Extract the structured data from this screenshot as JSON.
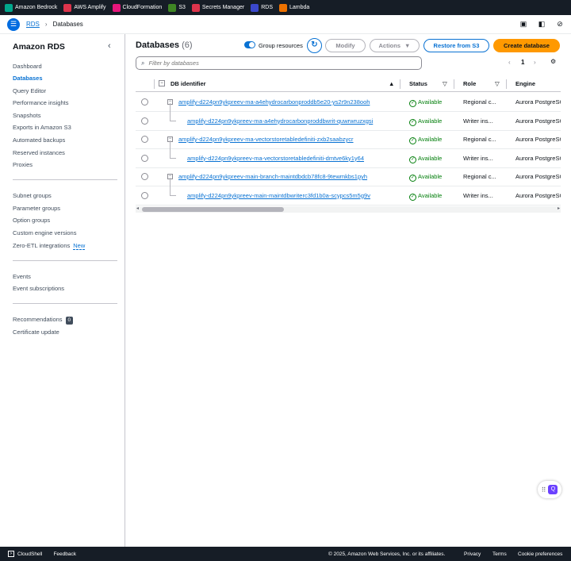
{
  "topbar": {
    "services": [
      {
        "label": "Amazon Bedrock",
        "icon": "bedrock-icon",
        "color": "#01a88d"
      },
      {
        "label": "AWS Amplify",
        "icon": "amplify-icon",
        "color": "#dd344c"
      },
      {
        "label": "CloudFormation",
        "icon": "cloudformation-icon",
        "color": "#e7157b"
      },
      {
        "label": "S3",
        "icon": "s3-icon",
        "color": "#3f8624"
      },
      {
        "label": "Secrets Manager",
        "icon": "secrets-manager-icon",
        "color": "#dd344c"
      },
      {
        "label": "RDS",
        "icon": "rds-icon",
        "color": "#3b48cc"
      },
      {
        "label": "Lambda",
        "icon": "lambda-icon",
        "color": "#ed7100"
      }
    ]
  },
  "breadcrumb": {
    "root": "RDS",
    "current": "Databases"
  },
  "sidebar": {
    "title": "Amazon RDS",
    "group1": [
      "Dashboard",
      "Databases",
      "Query Editor",
      "Performance insights",
      "Snapshots",
      "Exports in Amazon S3",
      "Automated backups",
      "Reserved instances",
      "Proxies"
    ],
    "group2": [
      "Subnet groups",
      "Parameter groups",
      "Option groups",
      "Custom engine versions"
    ],
    "zero_etl": "Zero-ETL integrations",
    "new_tag": "New",
    "group3": [
      "Events",
      "Event subscriptions"
    ],
    "recommendations": "Recommendations",
    "recommendations_count": "0",
    "certificate": "Certificate update"
  },
  "main": {
    "title": "Databases",
    "count": "(6)",
    "group_resources": "Group resources",
    "modify": "Modify",
    "actions": "Actions",
    "restore": "Restore from S3",
    "create": "Create database",
    "filter_placeholder": "Filter by databases",
    "page": "1"
  },
  "table": {
    "columns": [
      "DB identifier",
      "Status",
      "Role",
      "Engine"
    ],
    "rows": [
      {
        "id": "amplify-d224pn9ykpreev-ma-a4ehydrocarbonproddb5e20-ys2r9n238ooh",
        "status": "Available",
        "role": "Regional c...",
        "engine": "Aurora PostgreSQL",
        "child": false
      },
      {
        "id": "amplify-d224pn9ykpreev-ma-a4ehydrocarbonproddbwrit-quwrwruzxgsi",
        "status": "Available",
        "role": "Writer ins...",
        "engine": "Aurora PostgreSQL",
        "child": true
      },
      {
        "id": "amplify-d224pn9ykpreev-ma-vectorstoretabledefiniti-zxb2saabzycr",
        "status": "Available",
        "role": "Regional c...",
        "engine": "Aurora PostgreSQL",
        "child": false
      },
      {
        "id": "amplify-d224pn9ykpreev-ma-vectorstoretabledefiniti-dmtve6ky1y64",
        "status": "Available",
        "role": "Writer ins...",
        "engine": "Aurora PostgreSQL",
        "child": true
      },
      {
        "id": "amplify-d224pn9ykpreev-main-branch-maintdbdcb78fc8-9tewmkbs1pyh",
        "status": "Available",
        "role": "Regional c...",
        "engine": "Aurora PostgreSQL",
        "child": false
      },
      {
        "id": "amplify-d224pn9ykpreev-main-maintdbwriterc3fd1b0a-scypcs5m5g9v",
        "status": "Available",
        "role": "Writer ins...",
        "engine": "Aurora PostgreSQL",
        "child": true
      }
    ]
  },
  "footer": {
    "cloudshell": "CloudShell",
    "feedback": "Feedback",
    "copyright": "© 2025, Amazon Web Services, Inc. or its affiliates.",
    "privacy": "Privacy",
    "terms": "Terms",
    "cookie": "Cookie preferences"
  }
}
